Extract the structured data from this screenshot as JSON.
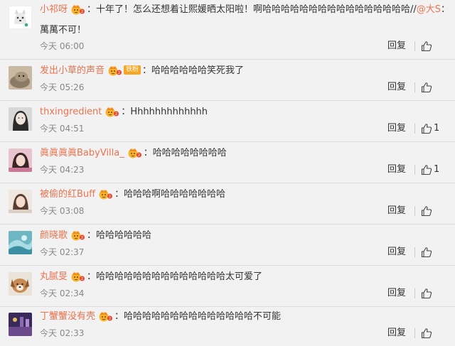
{
  "comments": [
    {
      "username": "小祁呀",
      "badge_icon": "vip-crown-icon",
      "text": "：十年了！怎么还想着让熙媛晒太阳啦！啊哈哈哈哈哈哈哈哈哈哈哈哈哈哈哈哈//",
      "mention": "@大S",
      "text2": "：",
      "continuation": "萬萬不可！",
      "time": "今天 06:00",
      "reply_label": "回复",
      "avatar_icon": "cartoon-dog-avatar-icon"
    },
    {
      "username": "发出小草的声音",
      "badge_icon": "vip-crown-icon",
      "tag": "铁粉",
      "text": "：哈哈哈哈哈哈笑死我了",
      "time": "今天 05:26",
      "reply_label": "回复",
      "avatar_icon": "cat-photo-avatar-icon"
    },
    {
      "username": "thxingredient",
      "badge_icon": "vip-crown-icon",
      "text": "：Hhhhhhhhhhhhh",
      "time": "今天 04:51",
      "reply_label": "回复",
      "like_count": "1",
      "avatar_icon": "portrait-avatar-icon"
    },
    {
      "username": "眞眞眞眞BabyVilla_",
      "badge_icon": "vip-crown-icon",
      "text": "：哈哈哈哈哈哈哈哈",
      "time": "今天 04:23",
      "reply_label": "回复",
      "like_count": "1",
      "avatar_icon": "girl-pink-avatar-icon"
    },
    {
      "username": "被偷的红Buff",
      "badge_icon": "vip-crown-icon",
      "text": "：哈哈哈啊哈哈哈哈哈哈哈",
      "time": "今天 03:08",
      "reply_label": "回复",
      "avatar_icon": "girl-avatar-icon"
    },
    {
      "username": "颜晓歌",
      "badge_icon": "vip-crown-icon",
      "text": "：哈哈哈哈哈哈",
      "time": "今天 02:37",
      "reply_label": "回复",
      "avatar_icon": "blue-abstract-avatar-icon"
    },
    {
      "username": "丸腻旻",
      "badge_icon": "vip-crown-icon",
      "text": "：哈哈哈哈哈哈哈哈哈哈哈哈哈哈太可爱了",
      "time": "今天 02:34",
      "reply_label": "回复",
      "avatar_icon": "dog-photo-avatar-icon"
    },
    {
      "username": "丁蟹蟹没有壳",
      "badge_icon": "vip-crown-icon",
      "text": "：哈哈哈哈哈哈哈哈哈哈哈哈哈哈不可能",
      "time": "今天 02:33",
      "reply_label": "回复",
      "avatar_icon": "purple-scene-avatar-icon"
    }
  ]
}
